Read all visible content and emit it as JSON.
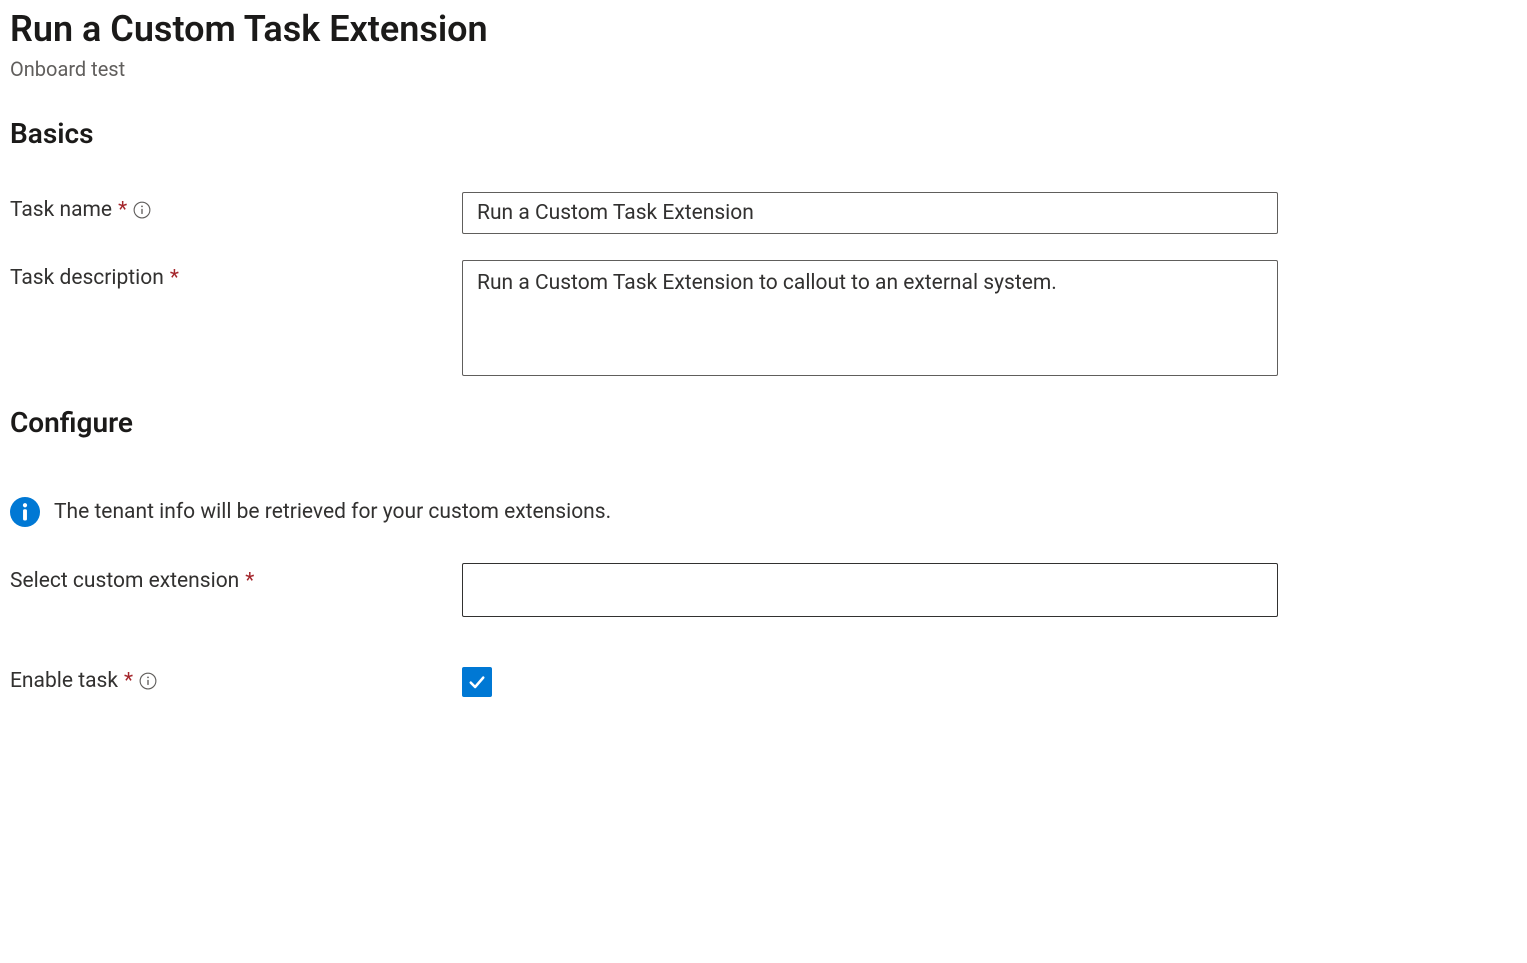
{
  "page": {
    "title": "Run a Custom Task Extension",
    "subtitle": "Onboard test"
  },
  "sections": {
    "basics": {
      "heading": "Basics",
      "task_name": {
        "label": "Task name",
        "required": "*",
        "value": "Run a Custom Task Extension"
      },
      "task_description": {
        "label": "Task description",
        "required": "*",
        "value": "Run a Custom Task Extension to callout to an external system."
      }
    },
    "configure": {
      "heading": "Configure",
      "info_text": "The tenant info will be retrieved for your custom extensions.",
      "select_ext": {
        "label": "Select custom extension",
        "required": "*",
        "value": ""
      },
      "enable_task": {
        "label": "Enable task",
        "required": "*",
        "checked": true
      }
    }
  }
}
